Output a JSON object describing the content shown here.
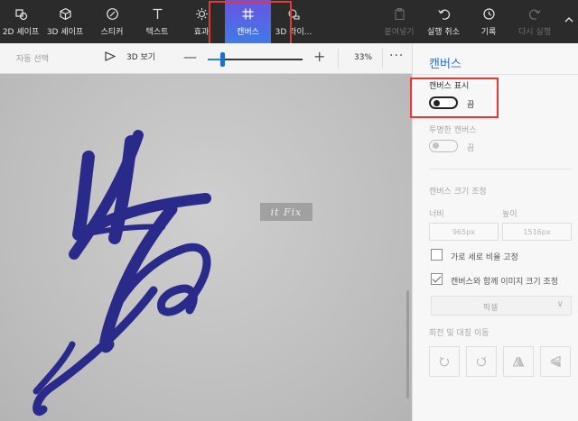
{
  "toolbar": {
    "tools": [
      {
        "label": "2D 셰이프",
        "icon": "2d-shapes-icon"
      },
      {
        "label": "3D 셰이프",
        "icon": "3d-shapes-icon"
      },
      {
        "label": "스티커",
        "icon": "sticker-icon"
      },
      {
        "label": "텍스트",
        "icon": "text-icon"
      },
      {
        "label": "효과",
        "icon": "effects-icon"
      },
      {
        "label": "캔버스",
        "icon": "canvas-icon",
        "active": true
      },
      {
        "label": "3D 라이...",
        "icon": "3d-library-icon"
      }
    ],
    "actions": [
      {
        "label": "붙여넣기",
        "icon": "paste-icon",
        "enabled": false
      },
      {
        "label": "실행 취소",
        "icon": "undo-icon",
        "enabled": true
      },
      {
        "label": "기록",
        "icon": "history-icon",
        "enabled": true
      },
      {
        "label": "다시 실행",
        "icon": "redo-icon",
        "enabled": false
      }
    ],
    "collapse_icon": "chevron-up-icon",
    "accent_color": "#4f6de4"
  },
  "subbar": {
    "auto_select": "자동 선택",
    "view_3d": "3D 보기",
    "zoom_percent": "33%",
    "zoom_slider_fraction": 0.15,
    "more": "···"
  },
  "canvas": {
    "watermark": "it Fix"
  },
  "panel": {
    "title": "캔버스",
    "show_canvas": {
      "label": "캔버스 표시",
      "state": "끔",
      "on": false
    },
    "transparent_canvas": {
      "label": "투명한 캔버스",
      "state": "끔",
      "on": false
    },
    "resize_section": "캔버스 크기 조정",
    "width_label": "너비",
    "height_label": "높이",
    "width_value": "965px",
    "height_value": "1516px",
    "lock_aspect": {
      "label": "가로 세로 비율 고정",
      "checked": false
    },
    "resize_image": {
      "label": "캔버스와 함께 이미지 크기 조정",
      "checked": true
    },
    "unit_select": "픽셀",
    "rotate_section": "회전 및 대칭 이동"
  }
}
